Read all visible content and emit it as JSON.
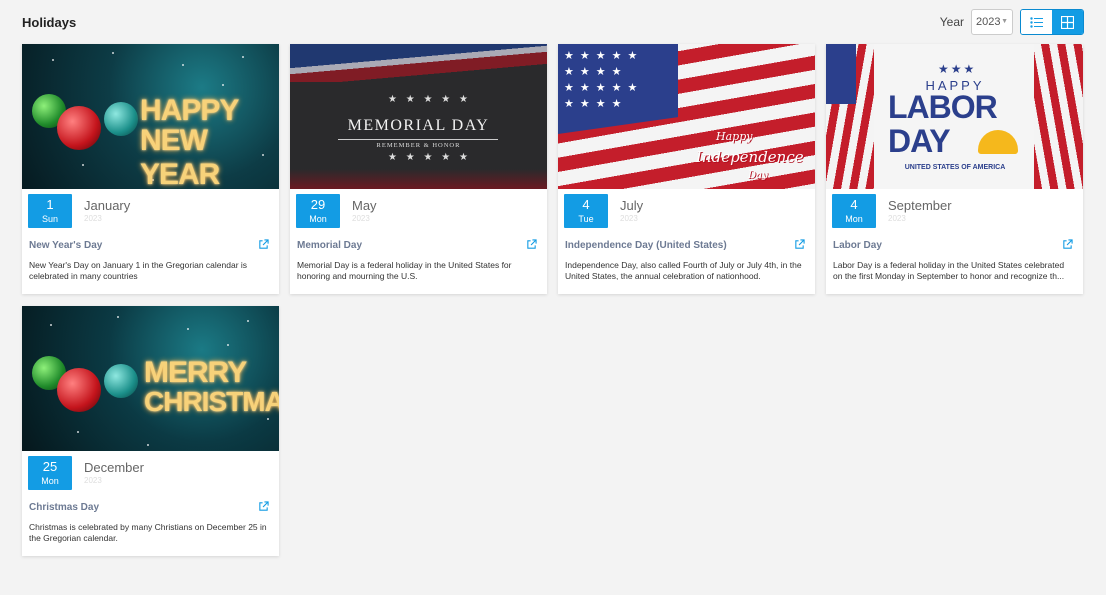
{
  "header": {
    "title": "Holidays",
    "year_label": "Year",
    "year_value": "2023",
    "view_modes": [
      "list",
      "grid"
    ],
    "active_view": "grid"
  },
  "colors": {
    "accent": "#139ce4",
    "title_text": "#6d7a93",
    "page_bg": "#f3f3f3"
  },
  "holidays": [
    {
      "day": "1",
      "weekday": "Sun",
      "month": "January",
      "year": "2023",
      "name": "New Year's Day",
      "description": "New Year's Day on January 1 in the Gregorian calendar is celebrated in many countries",
      "banner_line1": "HAPPY",
      "banner_line2": "NEW YEAR"
    },
    {
      "day": "29",
      "weekday": "Mon",
      "month": "May",
      "year": "2023",
      "name": "Memorial Day",
      "description": "Memorial Day is a federal holiday in the United States for honoring and mourning the U.S.",
      "banner_line1": "MEMORIAL DAY",
      "banner_line2": "REMEMBER & HONOR"
    },
    {
      "day": "4",
      "weekday": "Tue",
      "month": "July",
      "year": "2023",
      "name": "Independence Day (United States)",
      "description": "Independence Day, also called Fourth of July or July 4th, in the United States, the annual celebration of nationhood.",
      "banner_line1": "Happy",
      "banner_line2": "Independence",
      "banner_line3": "Day"
    },
    {
      "day": "4",
      "weekday": "Mon",
      "month": "September",
      "year": "2023",
      "name": "Labor Day",
      "description": "Labor Day is a federal holiday in the United States celebrated on the first Monday in September to honor and recognize th...",
      "banner_line1": "HAPPY",
      "banner_line2": "LABOR",
      "banner_line3": "DAY",
      "banner_line4": "UNITED STATES OF AMERICA"
    },
    {
      "day": "25",
      "weekday": "Mon",
      "month": "December",
      "year": "2023",
      "name": "Christmas Day",
      "description": "Christmas is celebrated by many Christians on December 25 in the Gregorian calendar.",
      "banner_line1": "MERRY",
      "banner_line2": "CHRISTMAS"
    }
  ]
}
